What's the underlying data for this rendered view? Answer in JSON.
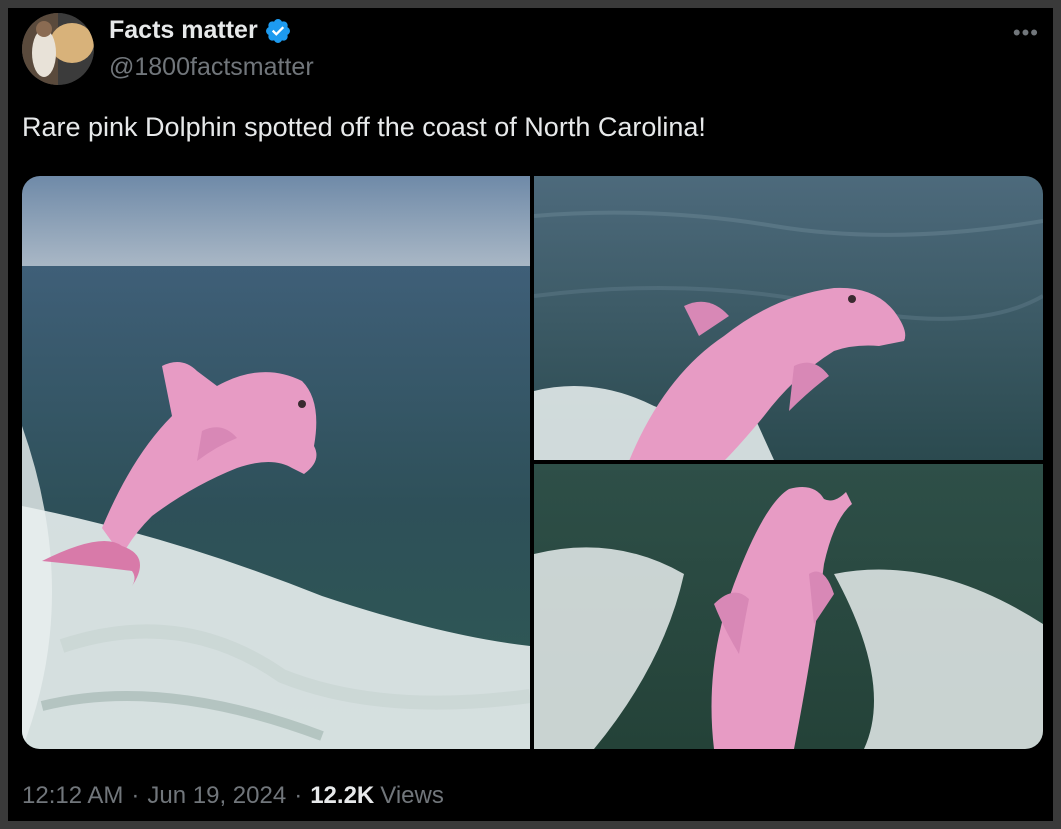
{
  "author": {
    "display_name": "Facts matter",
    "handle": "@1800factsmatter",
    "verified_icon": "verified-badge-icon",
    "avatar_icon": "user-avatar"
  },
  "tweet": {
    "text": "Rare pink Dolphin spotted off the coast of North Carolina!",
    "time": "12:12 AM",
    "date": "Jun 19, 2024",
    "separator": "·",
    "views_count": "12.2K",
    "views_label": "Views",
    "more_label": "•••"
  },
  "colors": {
    "background": "#000000",
    "text_primary": "#e7e9ea",
    "text_secondary": "#71767b",
    "verified_blue": "#1d9bf0",
    "dolphin_pink": "#e79bc4",
    "sea_green": "#2e4f52"
  }
}
